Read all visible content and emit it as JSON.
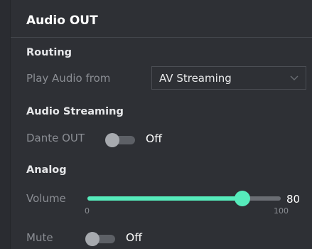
{
  "panel": {
    "title": "Audio OUT"
  },
  "routing": {
    "section_title": "Routing",
    "play_audio_label": "Play Audio from",
    "play_audio_value": "AV Streaming"
  },
  "audio_streaming": {
    "section_title": "Audio Streaming",
    "dante_out_label": "Dante OUT",
    "dante_out_state": "Off",
    "dante_out_on": false
  },
  "analog": {
    "section_title": "Analog",
    "volume_label": "Volume",
    "volume_value": "80",
    "volume_min": "0",
    "volume_max": "100",
    "volume_level": 80,
    "mute_label": "Mute",
    "mute_state": "Off",
    "mute_on": false
  },
  "colors": {
    "accent": "#56ebbb",
    "background": "#2e3035",
    "toggle_off": "#5d6066"
  },
  "icons": {
    "select_arrow": "chevron-down-icon"
  }
}
